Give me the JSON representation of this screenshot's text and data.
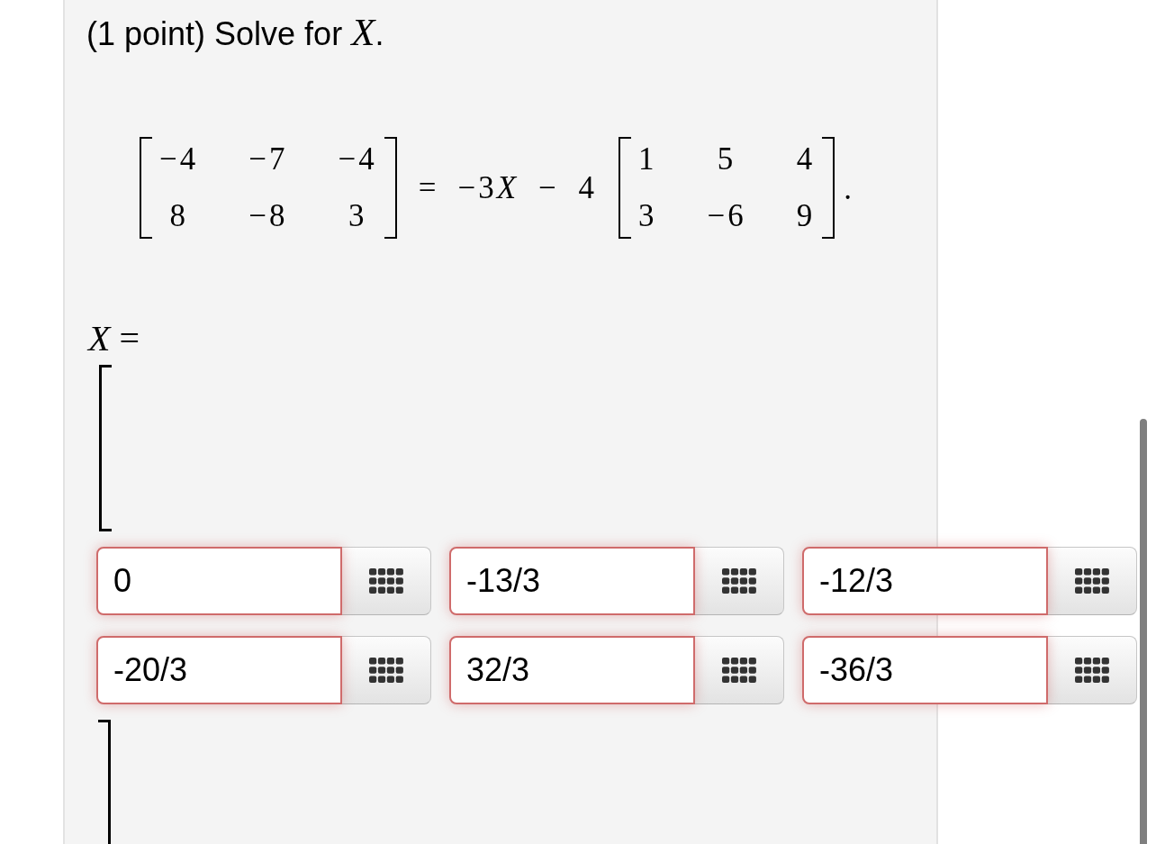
{
  "problem": {
    "prompt": "(1 point) Solve for *X*."
  },
  "equation": {
    "left_matrix": [
      [
        "−4",
        "−7",
        "−4"
      ],
      [
        "8",
        "−8",
        "3"
      ]
    ],
    "operator": "=",
    "expression": [
      "−3",
      "*X*",
      " − 4"
    ],
    "right_matrix": [
      [
        "1",
        "5",
        "4"
      ],
      [
        "3",
        "−6",
        "9"
      ]
    ],
    "end": "."
  },
  "answer": {
    "label": "*X* =",
    "rows": [
      [
        {
          "value": "0",
          "incorrect": true
        },
        {
          "value": "-13/3",
          "incorrect": true
        },
        {
          "value": "-12/3",
          "incorrect": true
        }
      ],
      [
        {
          "value": "-20/3",
          "incorrect": true
        },
        {
          "value": "32/3",
          "incorrect": true
        },
        {
          "value": "-36/3",
          "incorrect": true
        }
      ]
    ]
  }
}
